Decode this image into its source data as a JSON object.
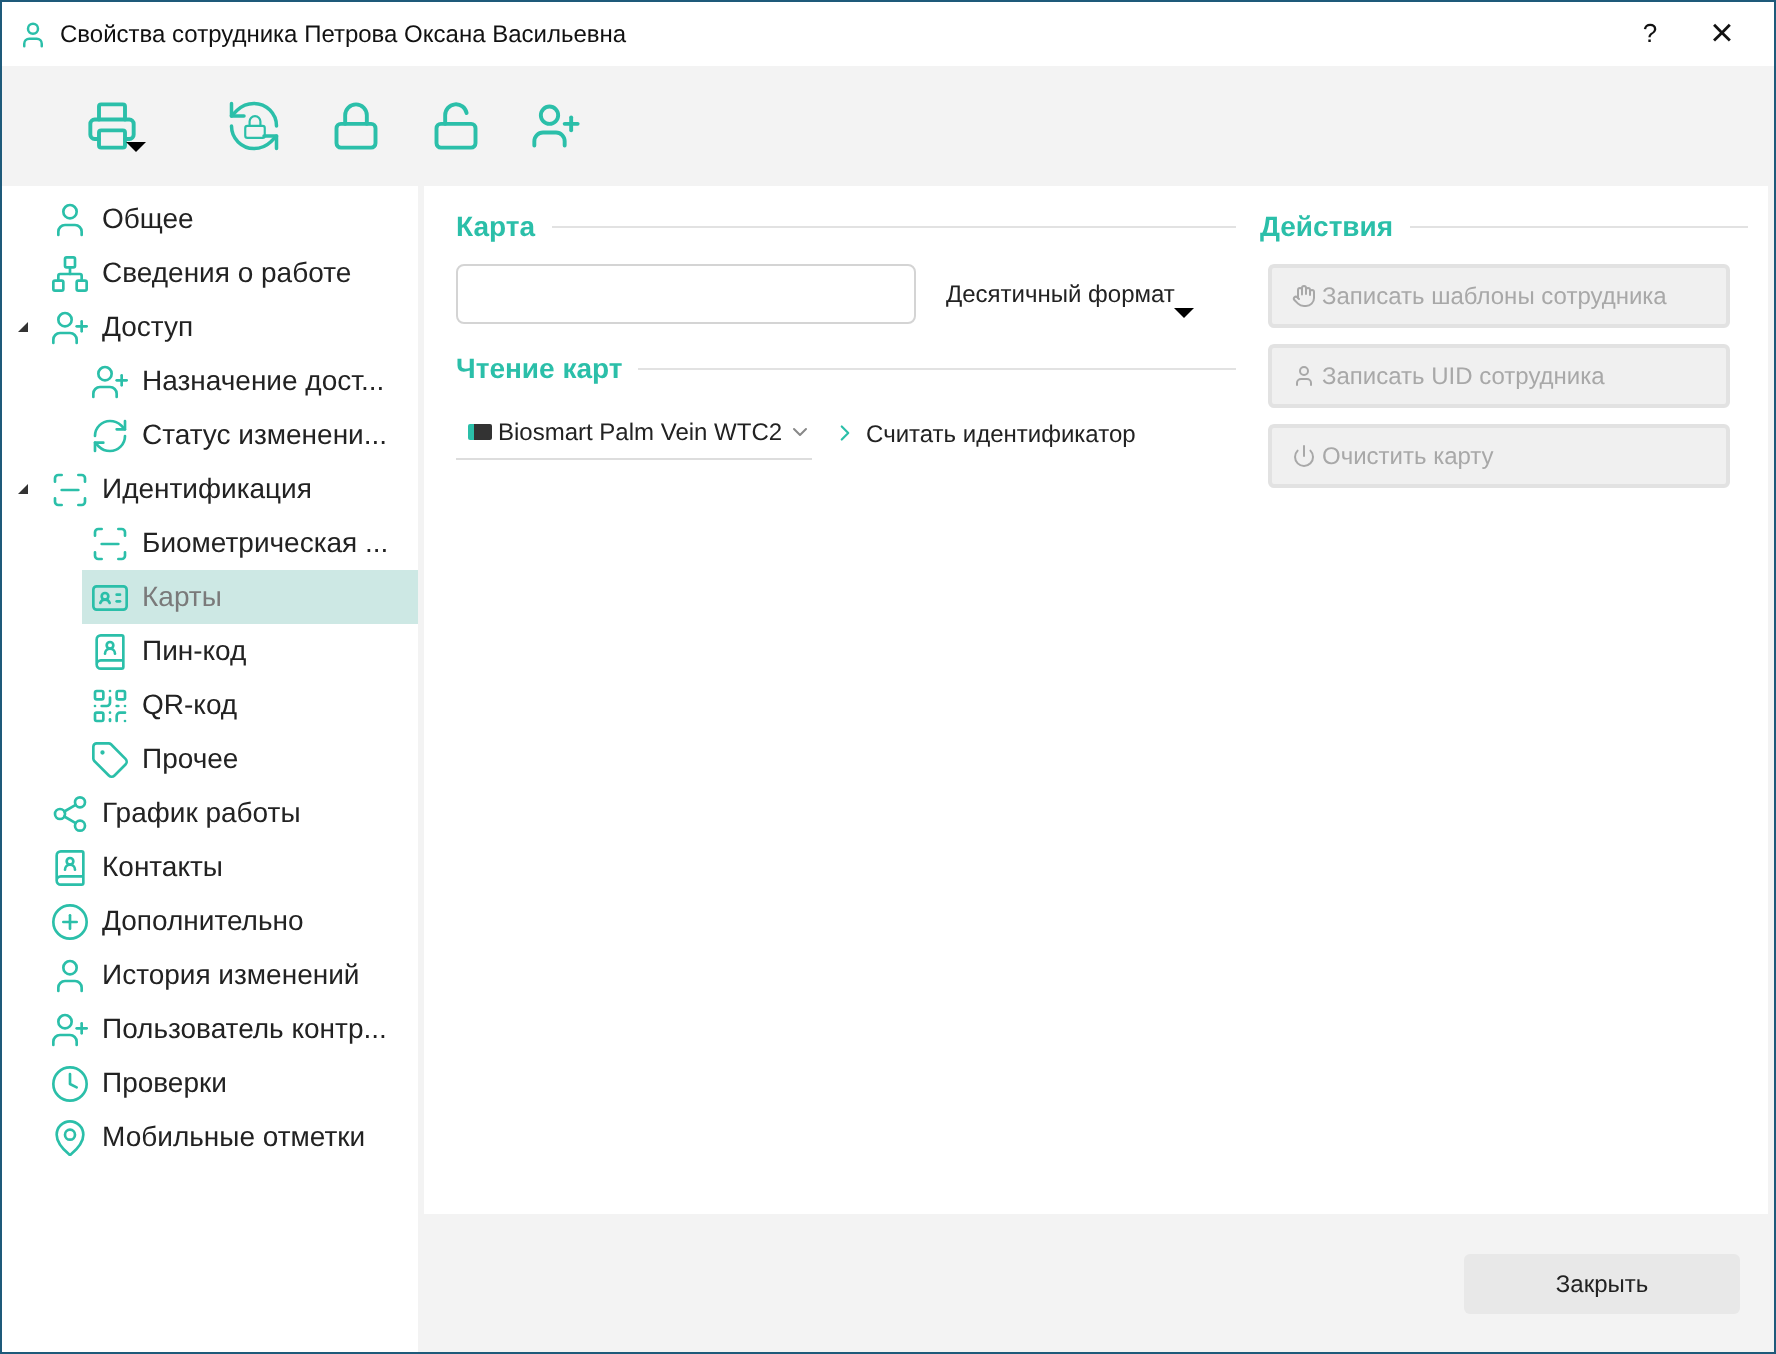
{
  "window": {
    "title": "Свойства сотрудника Петрова Оксана Васильевна",
    "help": "?",
    "close": "×"
  },
  "sidebar": {
    "items": [
      {
        "label": "Общее",
        "selected": false
      },
      {
        "label": "Сведения о работе",
        "selected": false
      },
      {
        "label": "Доступ",
        "selected": false,
        "expanded": true,
        "children": [
          {
            "label": "Назначение дост...",
            "selected": false
          },
          {
            "label": "Статус изменени...",
            "selected": false
          }
        ]
      },
      {
        "label": "Идентификация",
        "selected": false,
        "expanded": true,
        "children": [
          {
            "label": "Биометрическая ...",
            "selected": false
          },
          {
            "label": "Карты",
            "selected": true
          },
          {
            "label": "Пин-код",
            "selected": false
          },
          {
            "label": "QR-код",
            "selected": false
          },
          {
            "label": "Прочее",
            "selected": false
          }
        ]
      },
      {
        "label": "График работы",
        "selected": false
      },
      {
        "label": "Контакты",
        "selected": false
      },
      {
        "label": "Дополнительно",
        "selected": false
      },
      {
        "label": "История изменений",
        "selected": false
      },
      {
        "label": "Пользователь контр...",
        "selected": false
      },
      {
        "label": "Проверки",
        "selected": false
      },
      {
        "label": "Мобильные отметки",
        "selected": false
      }
    ]
  },
  "card": {
    "title": "Карта",
    "format": "Десятичный формат"
  },
  "reading": {
    "title": "Чтение карт",
    "device": "Biosmart Palm Vein WTC2",
    "read_link": "Считать идентификатор"
  },
  "actions": {
    "title": "Действия",
    "buttons": [
      {
        "label": "Записать шаблоны сотрудника",
        "disabled": true
      },
      {
        "label": "Записать UID сотрудника",
        "disabled": true
      },
      {
        "label": "Очистить карту",
        "disabled": true
      }
    ]
  },
  "footer": {
    "close_button": "Закрыть"
  }
}
